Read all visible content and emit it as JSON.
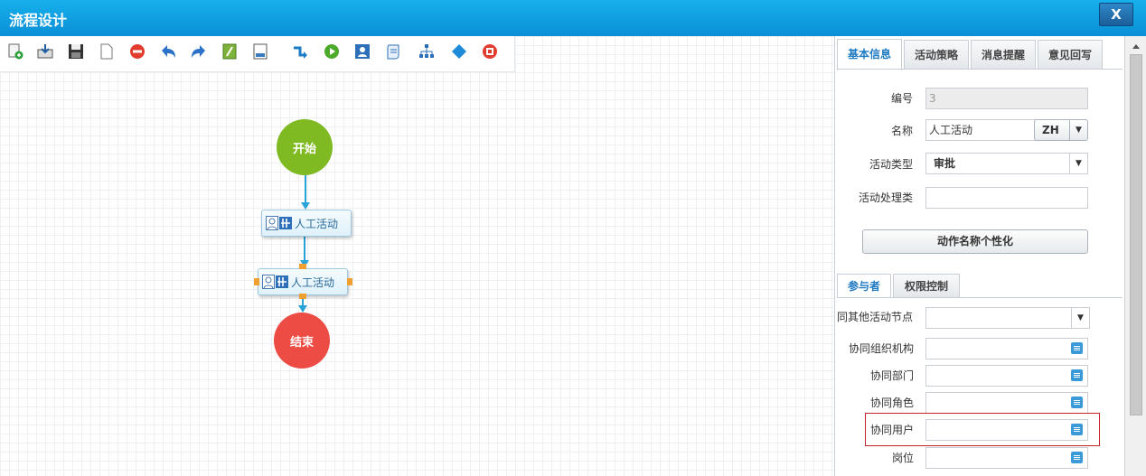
{
  "window": {
    "title": "流程设计",
    "close_label": "X"
  },
  "toolbar": {
    "icons": [
      "new-icon",
      "import-icon",
      "save-icon",
      "blank-page-icon",
      "delete-icon",
      "undo-icon",
      "redo-icon",
      "script-icon",
      "export-xml-icon",
      "transition-icon",
      "start-node-icon",
      "manual-activity-icon",
      "subprocess-icon",
      "org-tree-icon",
      "decision-icon",
      "end-node-icon"
    ]
  },
  "flow": {
    "start_label": "开始",
    "task1_label": "人工活动",
    "task2_label": "人工活动",
    "end_label": "结束"
  },
  "panel": {
    "tabs": [
      "基本信息",
      "活动策略",
      "消息提醒",
      "意见回写"
    ],
    "active_tab": "基本信息",
    "fields": {
      "id_label": "编号",
      "id_value": "3",
      "name_label": "名称",
      "name_value": "人工活动",
      "lang_value": "ZH",
      "type_label": "活动类型",
      "type_value": "审批",
      "handler_label": "活动处理类",
      "handler_value": ""
    },
    "action_button": "动作名称个性化",
    "sub_tabs": [
      "参与者",
      "权限控制"
    ],
    "participants": {
      "same_node_label": "同其他活动节点",
      "org_label": "协同组织机构",
      "dept_label": "协同部门",
      "role_label": "协同角色",
      "user_label": "协同用户",
      "post_label": "岗位"
    }
  },
  "colors": {
    "title_bar": "#0a8fd6",
    "start": "#7fba22",
    "end": "#ec4c44",
    "highlight": "#c8202a"
  }
}
